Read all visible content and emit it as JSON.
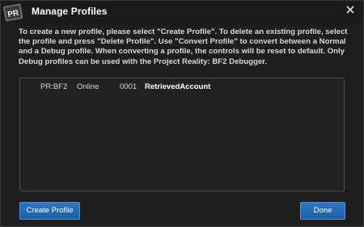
{
  "window": {
    "title": "Manage Profiles",
    "logo_text": "PR",
    "close_icon": "close-icon"
  },
  "description": "To create a new profile, please select \"Create Profile\". To delete an existing profile, select the profile and press \"Delete Profile\". Use \"Convert Profile\" to convert between a Normal and a Debug profile. When converting a profile, the controls will be reset to default. Only Debug profiles can be used with the Project Reality: BF2 Debugger.",
  "profiles": [
    {
      "mod": "PR:BF2",
      "type": "Online",
      "id": "0001",
      "name": "RetrievedAccount"
    }
  ],
  "buttons": {
    "create_label": "Create Profile",
    "done_label": "Done"
  },
  "colors": {
    "accent": "#2d78c2",
    "background": "#1e1e1e",
    "titlebar": "#1a1a1a",
    "text": "#d8d8d8"
  }
}
